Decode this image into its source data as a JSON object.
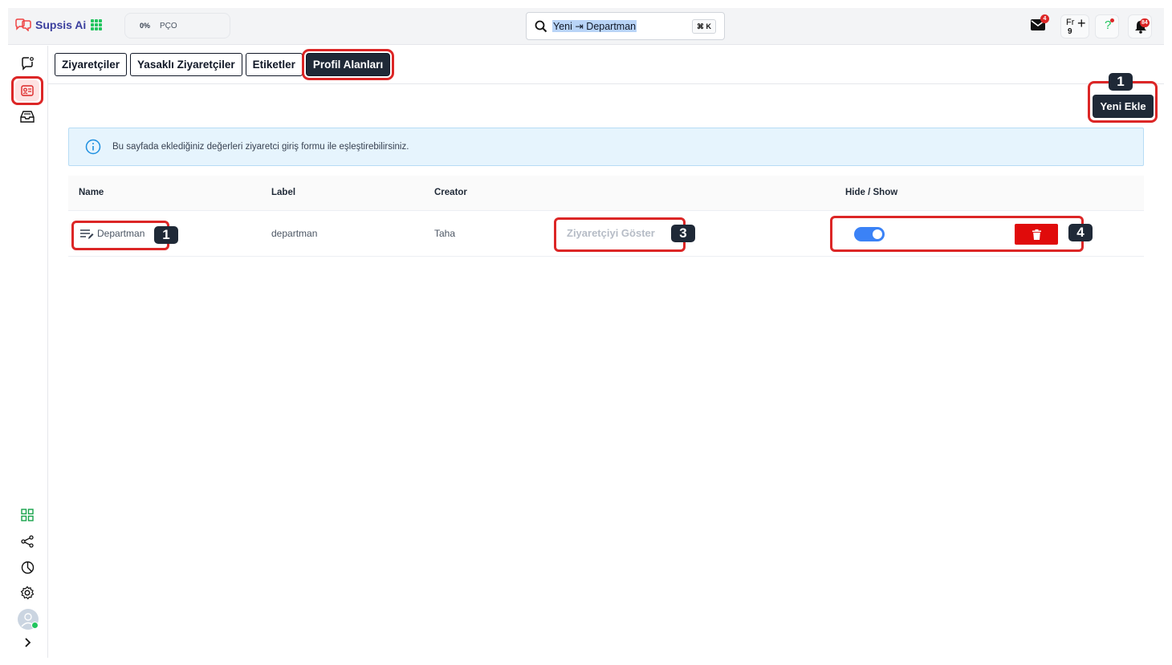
{
  "brand": {
    "name": "Supsis Ai"
  },
  "progress": {
    "percent": "0%",
    "label": "PÇO"
  },
  "search": {
    "value": "Yeni ⇥ Departman",
    "shortcut": "⌘ K"
  },
  "header": {
    "mail_badge": "4",
    "language": {
      "code": "Fr",
      "number": "9"
    },
    "help": "?",
    "notifications_badge": "84"
  },
  "tabs": [
    {
      "label": "Ziyaretçiler",
      "active": false
    },
    {
      "label": "Yasaklı Ziyaretçiler",
      "active": false
    },
    {
      "label": "Etiketler",
      "active": false
    },
    {
      "label": "Profil Alanları",
      "active": true
    }
  ],
  "actions": {
    "new_label": "Yeni Ekle"
  },
  "markers": {
    "new": "1",
    "name": "1",
    "show": "3",
    "actions": "4"
  },
  "info": {
    "text": "Bu sayfada eklediğiniz değerleri ziyaretci giriş formu ile eşleştirebilirsiniz."
  },
  "table": {
    "columns": [
      "Name",
      "Label",
      "Creator",
      "",
      "Hide / Show"
    ],
    "rows": [
      {
        "name": "Departman",
        "label": "departman",
        "creator": "Taha",
        "show_label": "Ziyaretçiyi Göster",
        "visible": true
      }
    ]
  },
  "colors": {
    "accent": "#dc2626",
    "dark": "#1f2937",
    "toggle": "#3b82f6",
    "delete": "#e00b0b"
  },
  "icons": [
    "chat-icon",
    "contact-card-icon",
    "inbox-icon",
    "apps-icon",
    "share-icon",
    "report-icon",
    "settings-icon",
    "chevron-right-icon",
    "trash-icon",
    "info-icon",
    "search-icon",
    "mail-icon",
    "bell-icon"
  ]
}
